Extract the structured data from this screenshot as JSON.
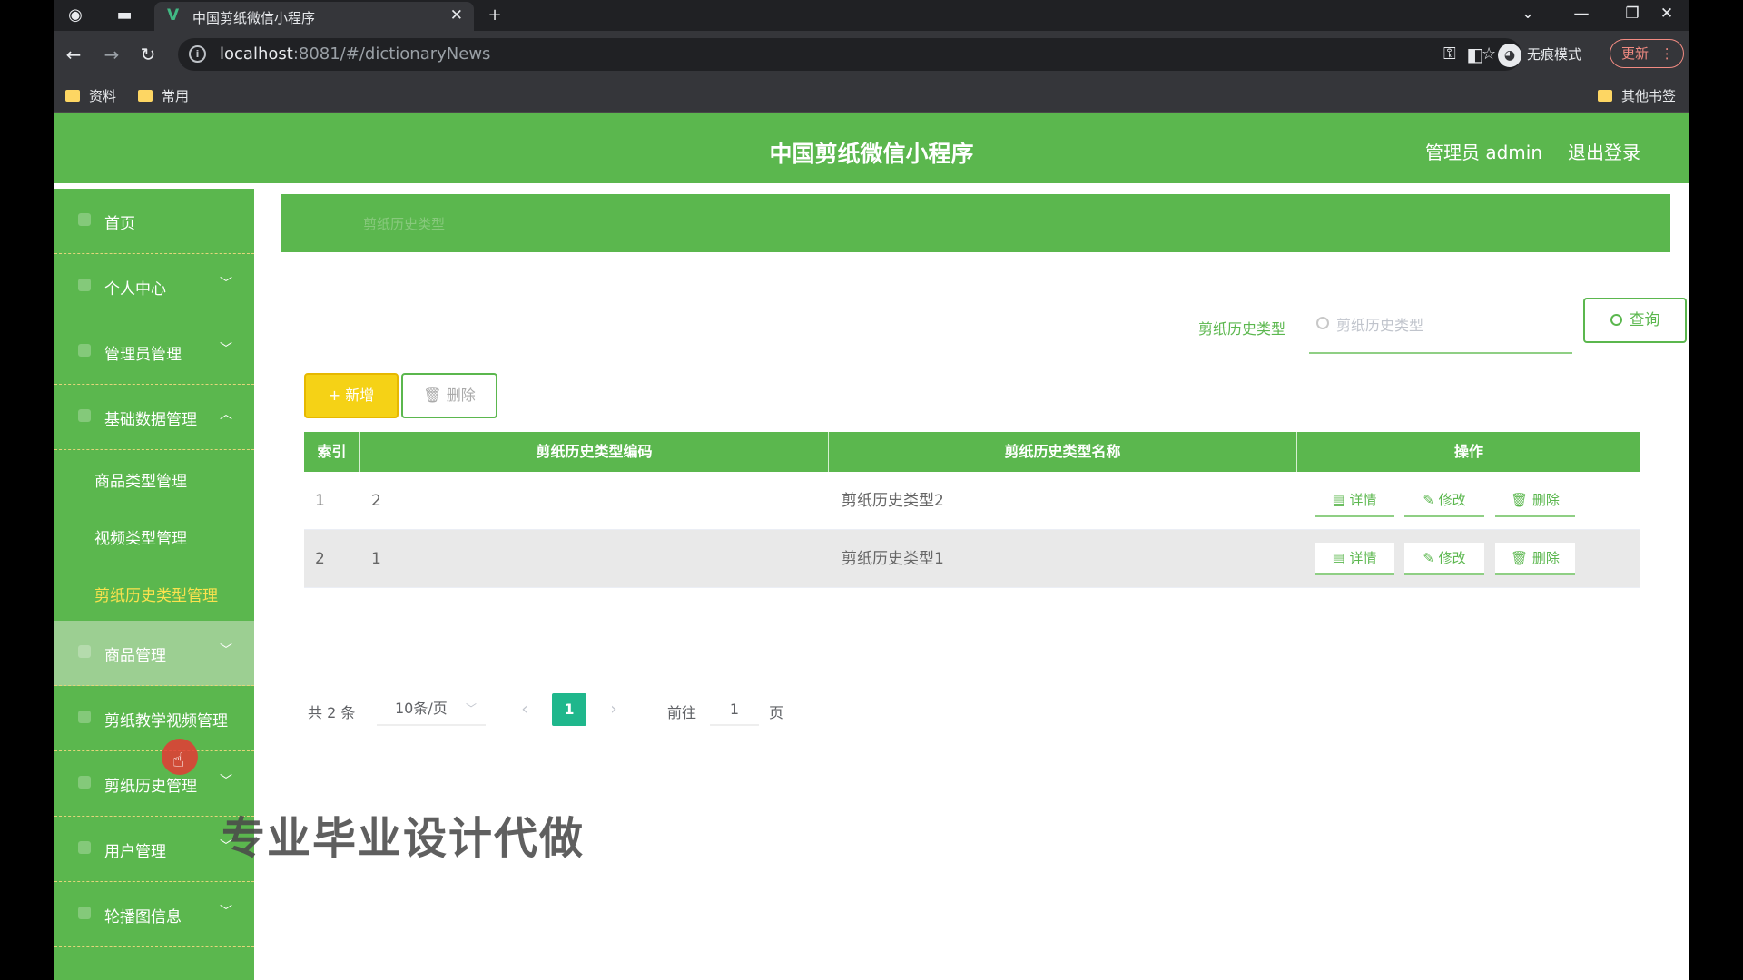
{
  "browser": {
    "tab_title": "中国剪纸微信小程序",
    "url_host": "localhost",
    "url_path": ":8081/#/dictionaryNews",
    "incognito_label": "无痕模式",
    "update_label": "更新",
    "bookmarks": [
      "资料",
      "常用"
    ],
    "other_bookmarks": "其他书签"
  },
  "header": {
    "title": "中国剪纸微信小程序",
    "admin_label": "管理员 admin",
    "logout_label": "退出登录"
  },
  "sidebar": {
    "items": [
      {
        "label": "首页"
      },
      {
        "label": "个人中心"
      },
      {
        "label": "管理员管理"
      },
      {
        "label": "基础数据管理"
      },
      {
        "label": "商品管理"
      },
      {
        "label": "剪纸教学视频管理"
      },
      {
        "label": "剪纸历史管理"
      },
      {
        "label": "用户管理"
      },
      {
        "label": "轮播图信息"
      }
    ],
    "sub_items": [
      {
        "label": "商品类型管理"
      },
      {
        "label": "视频类型管理"
      },
      {
        "label": "剪纸历史类型管理"
      }
    ]
  },
  "breadcrumb": "剪纸历史类型",
  "search": {
    "label": "剪纸历史类型",
    "placeholder": "剪纸历史类型",
    "button": "查询"
  },
  "actions": {
    "add": "+ 新增",
    "delete": "删除"
  },
  "table": {
    "headers": [
      "索引",
      "剪纸历史类型编码",
      "剪纸历史类型名称",
      "操作"
    ],
    "rows": [
      {
        "index": "1",
        "code": "2",
        "name": "剪纸历史类型2"
      },
      {
        "index": "2",
        "code": "1",
        "name": "剪纸历史类型1"
      }
    ],
    "ops": {
      "detail": "详情",
      "edit": "修改",
      "delete": "删除"
    }
  },
  "pagination": {
    "total": "共 2 条",
    "page_size": "10条/页",
    "current": "1",
    "goto_label": "前往",
    "goto_value": "1",
    "page_suffix": "页"
  },
  "watermark": "专业毕业设计代做",
  "colors": {
    "primary": "#5bb74e",
    "accent_yellow": "#f5d216",
    "active_page": "#1fb78c"
  }
}
